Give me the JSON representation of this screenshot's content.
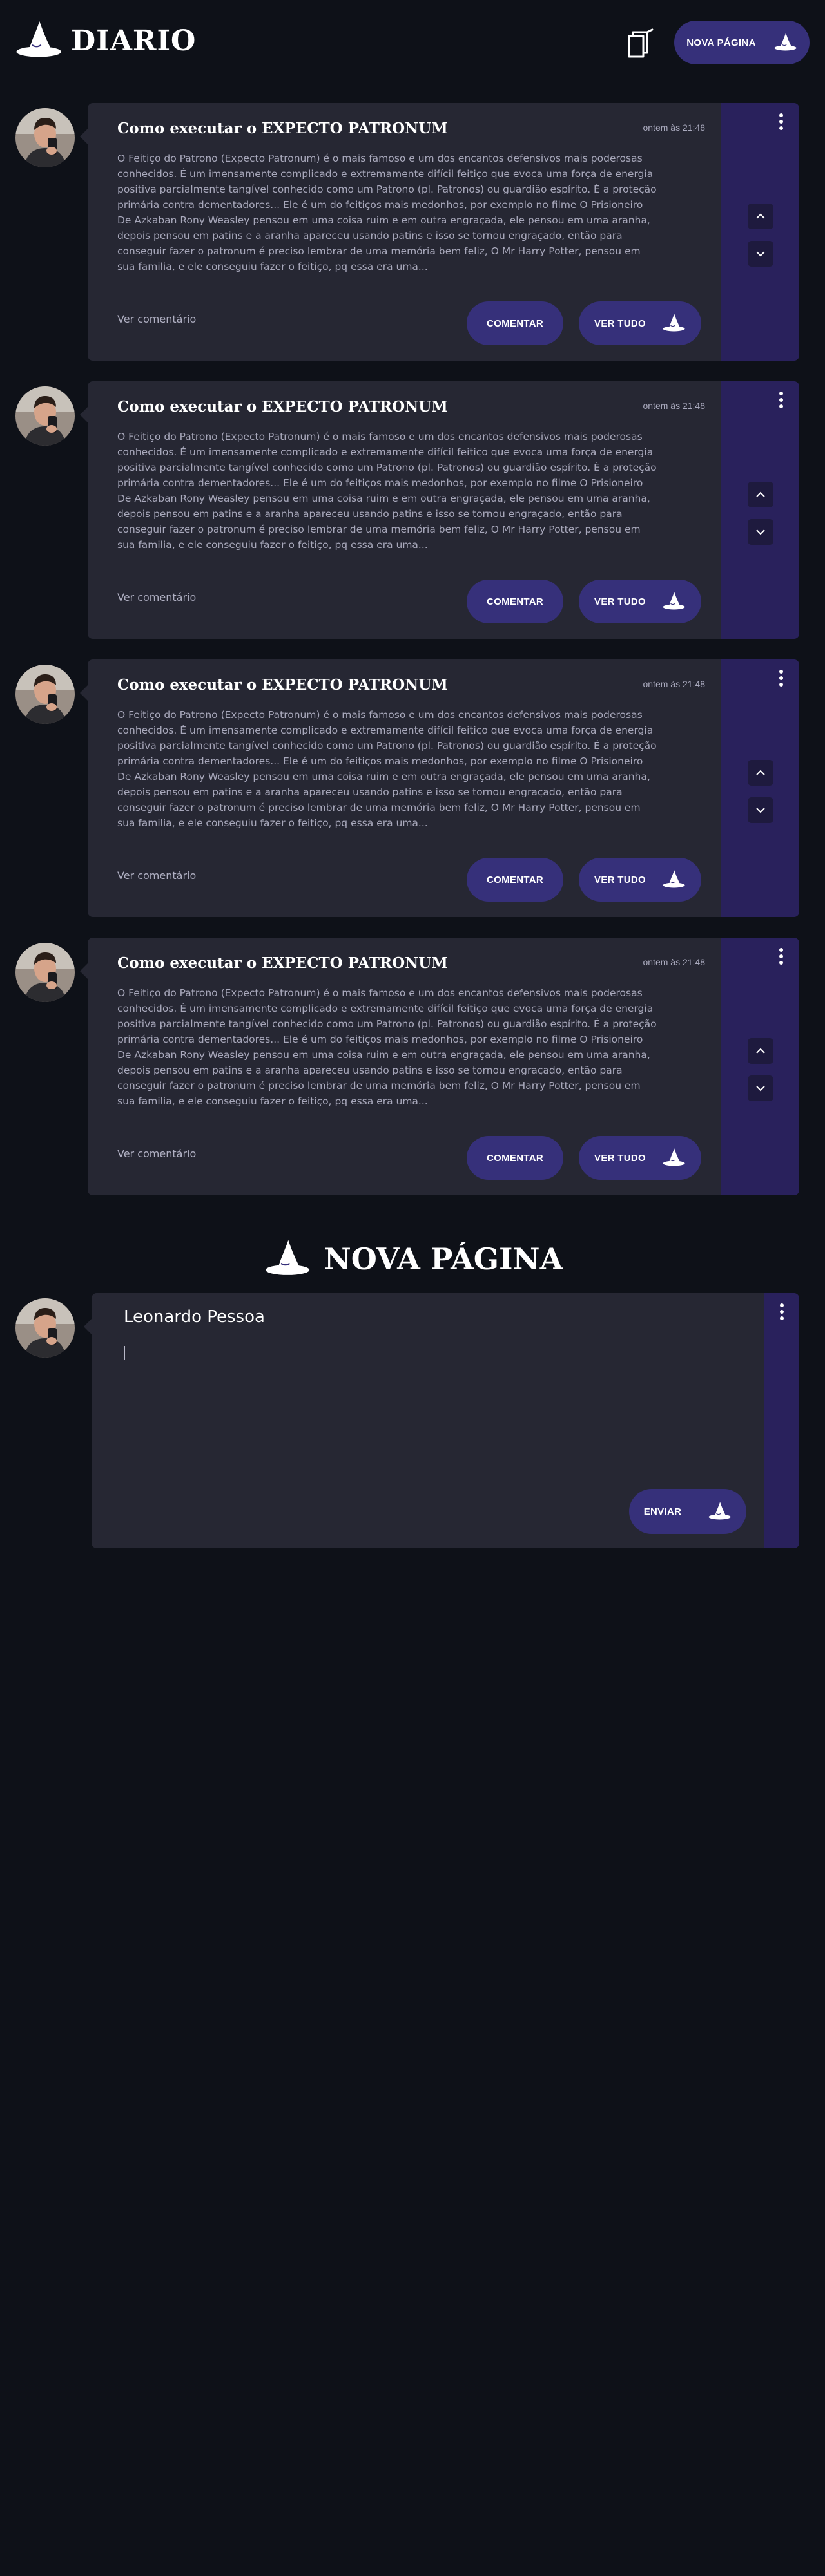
{
  "header": {
    "title": "DIARIO",
    "new_page_label": "NOVA PÁGINA"
  },
  "posts": [
    {
      "title": "Como executar o EXPECTO PATRONUM",
      "time": "ontem às 21:48",
      "body": "O Feitiço do Patrono (Expecto Patronum) é o mais famoso e um dos encantos defensivos mais poderosas conhecidos. É um imensamente complicado e extremamente difícil feitiço que evoca uma força de energia positiva parcialmente tangível conhecido como um Patrono (pl. Patronos) ou guardião espírito. É a proteção primária contra dementadores... Ele é um do feitiços mais medonhos, por exemplo no filme O Prisioneiro De Azkaban Rony Weasley pensou em uma coisa ruim e em outra engraçada, ele pensou em uma aranha, depois pensou em patins e a aranha apareceu usando patins e isso se tornou engraçado, então para conseguir fazer o patronum é preciso lembrar de uma memória bem feliz, O Mr Harry Potter, pensou em sua familia, e ele conseguiu fazer o feitiço, pq essa era uma...",
      "comment_link": "Ver comentário",
      "comment_label": "COMENTAR",
      "view_label": "VER TUDO"
    },
    {
      "title": "Como executar o EXPECTO PATRONUM",
      "time": "ontem às 21:48",
      "body": "O Feitiço do Patrono (Expecto Patronum) é o mais famoso e um dos encantos defensivos mais poderosas conhecidos. É um imensamente complicado e extremamente difícil feitiço que evoca uma força de energia positiva parcialmente tangível conhecido como um Patrono (pl. Patronos) ou guardião espírito. É a proteção primária contra dementadores... Ele é um do feitiços mais medonhos, por exemplo no filme O Prisioneiro De Azkaban Rony Weasley pensou em uma coisa ruim e em outra engraçada, ele pensou em uma aranha, depois pensou em patins e a aranha apareceu usando patins e isso se tornou engraçado, então para conseguir fazer o patronum é preciso lembrar de uma memória bem feliz, O Mr Harry Potter, pensou em sua familia, e ele conseguiu fazer o feitiço, pq essa era uma...",
      "comment_link": "Ver comentário",
      "comment_label": "COMENTAR",
      "view_label": "VER TUDO"
    },
    {
      "title": "Como executar o EXPECTO PATRONUM",
      "time": "ontem às 21:48",
      "body": "O Feitiço do Patrono (Expecto Patronum) é o mais famoso e um dos encantos defensivos mais poderosas conhecidos. É um imensamente complicado e extremamente difícil feitiço que evoca uma força de energia positiva parcialmente tangível conhecido como um Patrono (pl. Patronos) ou guardião espírito. É a proteção primária contra dementadores... Ele é um do feitiços mais medonhos, por exemplo no filme O Prisioneiro De Azkaban Rony Weasley pensou em uma coisa ruim e em outra engraçada, ele pensou em uma aranha, depois pensou em patins e a aranha apareceu usando patins e isso se tornou engraçado, então para conseguir fazer o patronum é preciso lembrar de uma memória bem feliz, O Mr Harry Potter, pensou em sua familia, e ele conseguiu fazer o feitiço, pq essa era uma...",
      "comment_link": "Ver comentário",
      "comment_label": "COMENTAR",
      "view_label": "VER TUDO"
    },
    {
      "title": "Como executar o EXPECTO PATRONUM",
      "time": "ontem às 21:48",
      "body": "O Feitiço do Patrono (Expecto Patronum) é o mais famoso e um dos encantos defensivos mais poderosas conhecidos. É um imensamente complicado e extremamente difícil feitiço que evoca uma força de energia positiva parcialmente tangível conhecido como um Patrono (pl. Patronos) ou guardião espírito. É a proteção primária contra dementadores... Ele é um do feitiços mais medonhos, por exemplo no filme O Prisioneiro De Azkaban Rony Weasley pensou em uma coisa ruim e em outra engraçada, ele pensou em uma aranha, depois pensou em patins e a aranha apareceu usando patins e isso se tornou engraçado, então para conseguir fazer o patronum é preciso lembrar de uma memória bem feliz, O Mr Harry Potter, pensou em sua familia, e ele conseguiu fazer o feitiço, pq essa era uma...",
      "comment_link": "Ver comentário",
      "comment_label": "COMENTAR",
      "view_label": "VER TUDO"
    }
  ],
  "new_page": {
    "title": "NOVA PÁGINA",
    "author": "Leonardo Pessoa",
    "input_value": "",
    "send_label": "ENVIAR"
  },
  "icons": {
    "brand": "wizard-hat-icon",
    "notebook": "notebook-icon",
    "more": "vertical-dots-icon",
    "up": "chevron-up-icon",
    "down": "chevron-down-icon"
  },
  "colors": {
    "background": "#0e1118",
    "card": "#262733",
    "rail": "#29215c",
    "button": "#36307a",
    "arrow_button": "#1e1a3e",
    "text_muted": "#a8a8bb"
  }
}
